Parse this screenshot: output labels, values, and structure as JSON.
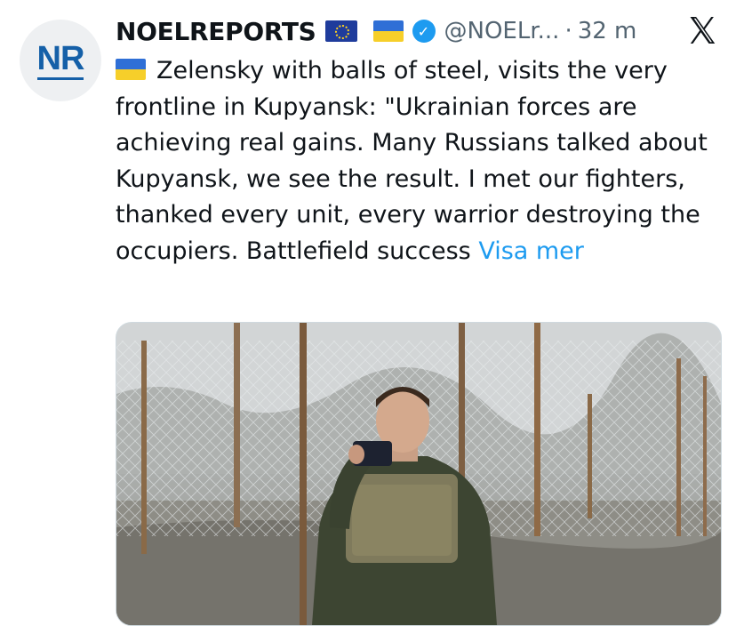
{
  "author": {
    "avatar_text": "NR",
    "display_name": "NOELREPORTS",
    "handle": "@NOELr...",
    "separator": "·",
    "time": "32 m",
    "verified": true
  },
  "icons": {
    "avatar": "noelreports-logo",
    "flag_1": "eu-flag-icon",
    "flag_2": "ukraine-flag-icon",
    "verified": "verified-badge-icon",
    "platform": "x-logo-icon"
  },
  "tweet": {
    "text": "Zelensky with balls of steel, visits the very frontline in Kupyansk: \"Ukrainian forces are achieving real gains. Many Russians talked about Kupyansk, we see the result. I met our fighters, thanked every unit, every warrior destroying the occupiers. Battlefield success",
    "show_more": "Visa mer"
  },
  "colors": {
    "link": "#1d9bf0",
    "secondary_text": "#536471",
    "primary_text": "#0f1419",
    "avatar_blue": "#1560a8"
  }
}
